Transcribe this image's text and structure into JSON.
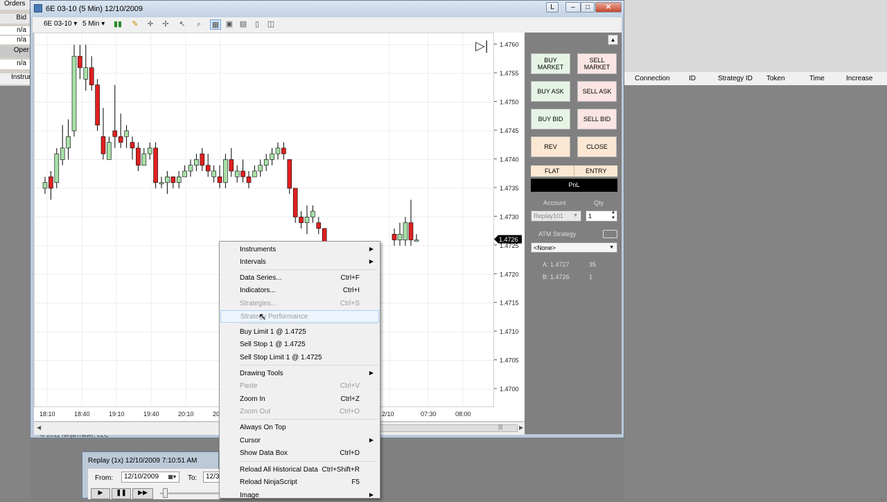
{
  "background": {
    "left_panel": {
      "orders_label": "Orders",
      "bid_label": "Bid",
      "na_values": [
        "n/a",
        "n/a",
        "n/a"
      ],
      "open_label": "Oper",
      "instrument_label": "Instrun"
    },
    "grid_columns": [
      "Connection",
      "ID",
      "Strategy ID",
      "Token",
      "Time",
      "Increase"
    ]
  },
  "chart_window": {
    "title": "6E 03-10 (5 Min)  12/10/2009",
    "title_buttons": {
      "link": "L",
      "minimize": "–",
      "maximize": "□",
      "close": "✕"
    },
    "toolbar": {
      "instrument": "6E 03-10",
      "interval": "5 Min"
    },
    "copyright": "© 2011 NinjaTrader, LLC",
    "price_ticks": [
      "1.4760",
      "1.4755",
      "1.4750",
      "1.4745",
      "1.4740",
      "1.4735",
      "1.4730",
      "1.4725",
      "1.4720",
      "1.4715",
      "1.4710",
      "1.4705",
      "1.4700"
    ],
    "last_price": "1.4726",
    "time_ticks": [
      "18:10",
      "18:40",
      "19:10",
      "19:40",
      "20:10",
      "20:",
      "2/10",
      "07:30",
      "08:00"
    ]
  },
  "chart_data": {
    "type": "candlestick",
    "ylim": [
      1.4697,
      1.4762
    ],
    "candles": [
      {
        "o": 1.4735,
        "h": 1.4737,
        "l": 1.4734,
        "c": 1.4736
      },
      {
        "o": 1.4737,
        "h": 1.4738,
        "l": 1.4733,
        "c": 1.4735
      },
      {
        "o": 1.4736,
        "h": 1.4742,
        "l": 1.4735,
        "c": 1.4741
      },
      {
        "o": 1.474,
        "h": 1.4746,
        "l": 1.4739,
        "c": 1.4742
      },
      {
        "o": 1.4742,
        "h": 1.4747,
        "l": 1.474,
        "c": 1.4744
      },
      {
        "o": 1.4745,
        "h": 1.476,
        "l": 1.4744,
        "c": 1.4758
      },
      {
        "o": 1.4758,
        "h": 1.476,
        "l": 1.4754,
        "c": 1.4756
      },
      {
        "o": 1.4754,
        "h": 1.476,
        "l": 1.4752,
        "c": 1.4756
      },
      {
        "o": 1.4756,
        "h": 1.4758,
        "l": 1.4752,
        "c": 1.4753
      },
      {
        "o": 1.4753,
        "h": 1.4754,
        "l": 1.4745,
        "c": 1.4746
      },
      {
        "o": 1.4744,
        "h": 1.4749,
        "l": 1.474,
        "c": 1.4741
      },
      {
        "o": 1.474,
        "h": 1.4744,
        "l": 1.474,
        "c": 1.4743
      },
      {
        "o": 1.4745,
        "h": 1.4753,
        "l": 1.4742,
        "c": 1.4744
      },
      {
        "o": 1.4744,
        "h": 1.4748,
        "l": 1.4742,
        "c": 1.4743
      },
      {
        "o": 1.4744,
        "h": 1.4746,
        "l": 1.4742,
        "c": 1.4745
      },
      {
        "o": 1.4743,
        "h": 1.4744,
        "l": 1.474,
        "c": 1.4742
      },
      {
        "o": 1.4742,
        "h": 1.4743,
        "l": 1.4738,
        "c": 1.4739
      },
      {
        "o": 1.4739,
        "h": 1.4742,
        "l": 1.4739,
        "c": 1.4741
      },
      {
        "o": 1.4741,
        "h": 1.4743,
        "l": 1.474,
        "c": 1.4742
      },
      {
        "o": 1.4742,
        "h": 1.4743,
        "l": 1.4735,
        "c": 1.4736
      },
      {
        "o": 1.4736,
        "h": 1.4737,
        "l": 1.4735,
        "c": 1.4736
      },
      {
        "o": 1.4736,
        "h": 1.4738,
        "l": 1.4734,
        "c": 1.4737
      },
      {
        "o": 1.4737,
        "h": 1.4737,
        "l": 1.4735,
        "c": 1.4736
      },
      {
        "o": 1.4736,
        "h": 1.4738,
        "l": 1.4735,
        "c": 1.4737
      },
      {
        "o": 1.4737,
        "h": 1.4739,
        "l": 1.4737,
        "c": 1.4738
      },
      {
        "o": 1.4738,
        "h": 1.474,
        "l": 1.4737,
        "c": 1.4739
      },
      {
        "o": 1.4739,
        "h": 1.4741,
        "l": 1.4738,
        "c": 1.474
      },
      {
        "o": 1.4741,
        "h": 1.4742,
        "l": 1.4738,
        "c": 1.4739
      },
      {
        "o": 1.4739,
        "h": 1.4741,
        "l": 1.4737,
        "c": 1.4738
      },
      {
        "o": 1.4737,
        "h": 1.4739,
        "l": 1.4736,
        "c": 1.4738
      },
      {
        "o": 1.4737,
        "h": 1.4739,
        "l": 1.4735,
        "c": 1.4736
      },
      {
        "o": 1.4736,
        "h": 1.4741,
        "l": 1.4735,
        "c": 1.474
      },
      {
        "o": 1.474,
        "h": 1.4742,
        "l": 1.4737,
        "c": 1.4738
      },
      {
        "o": 1.4737,
        "h": 1.4739,
        "l": 1.4736,
        "c": 1.4738
      },
      {
        "o": 1.4738,
        "h": 1.474,
        "l": 1.4736,
        "c": 1.4737
      },
      {
        "o": 1.4737,
        "h": 1.4738,
        "l": 1.4735,
        "c": 1.4736
      },
      {
        "o": 1.4737,
        "h": 1.4739,
        "l": 1.4737,
        "c": 1.4738
      },
      {
        "o": 1.4738,
        "h": 1.474,
        "l": 1.4737,
        "c": 1.4739
      },
      {
        "o": 1.4739,
        "h": 1.4741,
        "l": 1.4738,
        "c": 1.474
      },
      {
        "o": 1.474,
        "h": 1.4742,
        "l": 1.4739,
        "c": 1.4741
      },
      {
        "o": 1.4741,
        "h": 1.4743,
        "l": 1.474,
        "c": 1.4742
      },
      {
        "o": 1.4742,
        "h": 1.4743,
        "l": 1.474,
        "c": 1.4741
      },
      {
        "o": 1.474,
        "h": 1.474,
        "l": 1.4734,
        "c": 1.4735
      },
      {
        "o": 1.4735,
        "h": 1.4735,
        "l": 1.4729,
        "c": 1.473
      },
      {
        "o": 1.473,
        "h": 1.4731,
        "l": 1.4728,
        "c": 1.4729
      },
      {
        "o": 1.4729,
        "h": 1.4732,
        "l": 1.4727,
        "c": 1.473
      },
      {
        "o": 1.473,
        "h": 1.4732,
        "l": 1.4729,
        "c": 1.4731
      },
      {
        "o": 1.4729,
        "h": 1.473,
        "l": 1.4727,
        "c": 1.4728
      },
      {
        "o": 1.4728,
        "h": 1.4728,
        "l": 1.4725,
        "c": 1.4725
      }
    ],
    "hidden_candles": 6,
    "late_candles": [
      {
        "o": 1.4727,
        "h": 1.4728,
        "l": 1.4725,
        "c": 1.4726
      },
      {
        "o": 1.4726,
        "h": 1.4729,
        "l": 1.4725,
        "c": 1.4727
      },
      {
        "o": 1.4726,
        "h": 1.473,
        "l": 1.4725,
        "c": 1.4729
      },
      {
        "o": 1.4729,
        "h": 1.4733,
        "l": 1.4725,
        "c": 1.4726
      },
      {
        "o": 1.4726,
        "h": 1.4727,
        "l": 1.4726,
        "c": 1.4726
      }
    ],
    "up_color": "#a8e0a8",
    "down_color": "#e02020"
  },
  "chart_trader": {
    "buttons": {
      "buy_market": "BUY MARKET",
      "sell_market": "SELL MARKET",
      "buy_ask": "BUY ASK",
      "sell_ask": "SELL ASK",
      "buy_bid": "BUY BID",
      "sell_bid": "SELL BID",
      "rev": "REV",
      "close": "CLOSE"
    },
    "flat": "FLAT",
    "entry": "ENTRY",
    "pnl": "PnL",
    "account_label": "Account",
    "qty_label": "Qty",
    "account_value": "Replay101",
    "qty_value": "1",
    "atm_label": "ATM Strategy",
    "atm_value": "<None>",
    "ask": "A: 1.4727",
    "ask_size": "35",
    "bid": "B: 1.4726",
    "bid_size": "1"
  },
  "context_menu": {
    "items": [
      {
        "label": "Instruments",
        "shortcut": "",
        "submenu": true,
        "disabled": false
      },
      {
        "label": "Intervals",
        "shortcut": "",
        "submenu": true,
        "disabled": false
      },
      {
        "label": "Data Series...",
        "shortcut": "Ctrl+F",
        "submenu": false,
        "disabled": false
      },
      {
        "label": "Indicators...",
        "shortcut": "Ctrl+I",
        "submenu": false,
        "disabled": false
      },
      {
        "label": "Strategies...",
        "shortcut": "Ctrl+S",
        "submenu": false,
        "disabled": true
      },
      {
        "label": "Strategy Performance",
        "shortcut": "",
        "submenu": false,
        "disabled": true
      },
      {
        "label": "Buy Limit 1 @ 1.4725",
        "shortcut": "",
        "submenu": false,
        "disabled": false
      },
      {
        "label": "Sell Stop 1 @ 1.4725",
        "shortcut": "",
        "submenu": false,
        "disabled": false
      },
      {
        "label": "Sell Stop Limit 1 @ 1.4725",
        "shortcut": "",
        "submenu": false,
        "disabled": false
      },
      {
        "label": "Drawing Tools",
        "shortcut": "",
        "submenu": true,
        "disabled": false
      },
      {
        "label": "Paste",
        "shortcut": "Ctrl+V",
        "submenu": false,
        "disabled": true
      },
      {
        "label": "Zoom In",
        "shortcut": "Ctrl+Z",
        "submenu": false,
        "disabled": false
      },
      {
        "label": "Zoom Out",
        "shortcut": "Ctrl+O",
        "submenu": false,
        "disabled": true
      },
      {
        "label": "Always On Top",
        "shortcut": "",
        "submenu": false,
        "disabled": false
      },
      {
        "label": "Cursor",
        "shortcut": "",
        "submenu": true,
        "disabled": false
      },
      {
        "label": "Show Data Box",
        "shortcut": "Ctrl+D",
        "submenu": false,
        "disabled": false
      },
      {
        "label": "Reload All Historical Data",
        "shortcut": "Ctrl+Shift+R",
        "submenu": false,
        "disabled": false
      },
      {
        "label": "Reload NinjaScript",
        "shortcut": "F5",
        "submenu": false,
        "disabled": false
      },
      {
        "label": "Image",
        "shortcut": "",
        "submenu": true,
        "disabled": false
      }
    ]
  },
  "replay": {
    "title": "Replay (1x) 12/10/2009 7:10:51 AM",
    "from_label": "From:",
    "from_value": "12/10/2009",
    "to_label": "To:",
    "to_value": "12/3"
  }
}
